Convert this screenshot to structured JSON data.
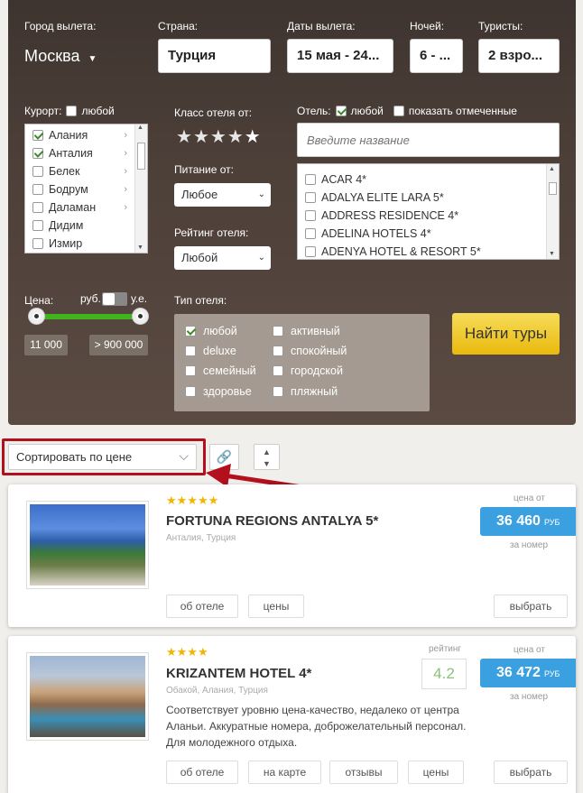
{
  "search": {
    "city_label": "Город вылета:",
    "city_value": "Москва",
    "country_label": "Страна:",
    "country_value": "Турция",
    "dates_label": "Даты вылета:",
    "dates_value": "15 мая - 24...",
    "nights_label": "Ночей:",
    "nights_value": "6 - ...",
    "tourists_label": "Туристы:",
    "tourists_value": "2 взро...",
    "resort_label": "Курорт:",
    "resort_any": "любой",
    "resorts": [
      "Алания",
      "Анталия",
      "Белек",
      "Бодрум",
      "Даламан",
      "Дидим",
      "Измир"
    ],
    "hotel_class_label": "Класс отеля от:",
    "food_label": "Питание от:",
    "food_value": "Любое",
    "rating_label": "Рейтинг отеля:",
    "rating_value": "Любой",
    "hotel_label": "Отель:",
    "hotel_any": "любой",
    "hotel_show_marked": "показать отмеченные",
    "hotel_search_placeholder": "Введите название",
    "hotels": [
      "ACAR 4*",
      "ADALYA ELITE LARA 5*",
      "ADDRESS RESIDENCE 4*",
      "ADELINA HOTELS 4*",
      "ADENYA HOTEL & RESORT 5*"
    ],
    "price_label": "Цена:",
    "currency_rub": "руб.",
    "currency_ue": "у.е.",
    "price_min": "11 000",
    "price_max": "> 900 000",
    "hotel_type_label": "Тип отеля:",
    "hotel_types": [
      "любой",
      "активный",
      "deluxe",
      "спокойный",
      "семейный",
      "городской",
      "здоровье",
      "пляжный"
    ],
    "find_button": "Найти туры"
  },
  "toolbar": {
    "sort_value": "Сортировать по цене"
  },
  "results": [
    {
      "name": "FORTUNA REGIONS ANTALYA 5*",
      "location": "Анталия, Турция",
      "price_from": "цена от",
      "price": "36 460",
      "currency": "РУБ",
      "per_room": "за номер",
      "btn_about": "об отеле",
      "btn_prices": "цены",
      "btn_select": "выбрать"
    },
    {
      "name": "KRIZANTEM HOTEL 4*",
      "location": "Обакой, Алания, Турция",
      "description": "Соответствует уровню цена-качество, недалеко от центра Аланьи. Аккуратные номера, доброжелательный персонал. Для молодежного отдыха.",
      "rating_label": "рейтинг",
      "rating": "4.2",
      "price_from": "цена от",
      "price": "36 472",
      "currency": "РУБ",
      "per_room": "за номер",
      "btn_about": "об отеле",
      "btn_map": "на карте",
      "btn_reviews": "отзывы",
      "btn_prices": "цены",
      "btn_select": "выбрать"
    }
  ],
  "colors": {
    "accent_red": "#b30f1c",
    "price_blue": "#3ba0e0",
    "find_yellow": "#f2c21a",
    "slider_green": "#3fb41f"
  }
}
